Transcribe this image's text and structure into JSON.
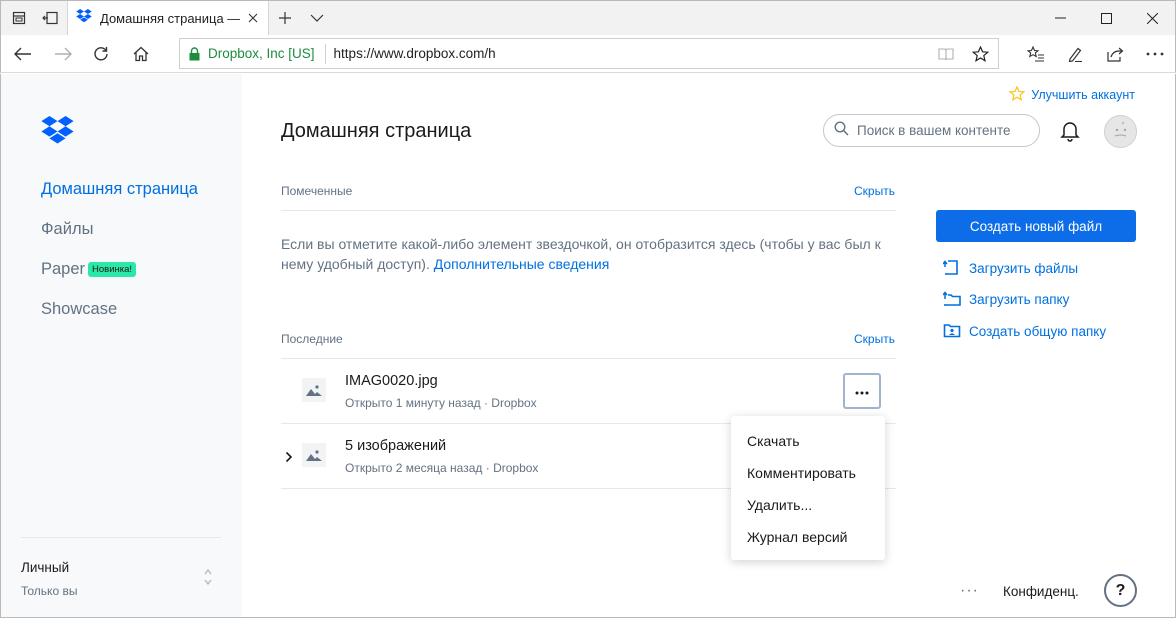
{
  "browser": {
    "tab_title": "Домашняя страница —",
    "address_org": "Dropbox, Inc [US]",
    "address_url": "https://www.dropbox.com/h"
  },
  "sidebar": {
    "items": [
      {
        "label": "Домашняя страница",
        "active": true
      },
      {
        "label": "Файлы",
        "active": false
      },
      {
        "label": "Paper",
        "active": false,
        "badge": "Новинка!"
      },
      {
        "label": "Showcase",
        "active": false
      }
    ],
    "account": {
      "name": "Личный",
      "subtitle": "Только вы"
    }
  },
  "header": {
    "upgrade": "Улучшить аккаунт",
    "title": "Домашняя страница",
    "search_placeholder": "Поиск в вашем контенте"
  },
  "starred": {
    "label": "Помеченные",
    "hide": "Скрыть",
    "empty_text": "Если вы отметите какой-либо элемент звездочкой, он отобразится здесь (чтобы у вас был к нему удобный доступ).",
    "more_link": "Дополнительные сведения"
  },
  "recent": {
    "label": "Последние",
    "hide": "Скрыть",
    "files": [
      {
        "name": "IMAG0020.jpg",
        "meta": "Открыто 1 минуту назад · Dropbox"
      },
      {
        "name": "5 изображений",
        "meta": "Открыто 2 месяца назад · Dropbox"
      }
    ]
  },
  "context_menu": {
    "items": [
      "Скачать",
      "Комментировать",
      "Удалить...",
      "Журнал версий"
    ]
  },
  "actions": {
    "create_file": "Создать новый файл",
    "upload_files": "Загрузить файлы",
    "upload_folder": "Загрузить папку",
    "shared_folder": "Создать общую папку"
  },
  "footer": {
    "more": "···",
    "privacy": "Конфиденц.",
    "help": "?"
  },
  "colors": {
    "accent": "#0061fe",
    "link": "#0070e0",
    "badge": "#2ae8a7"
  }
}
